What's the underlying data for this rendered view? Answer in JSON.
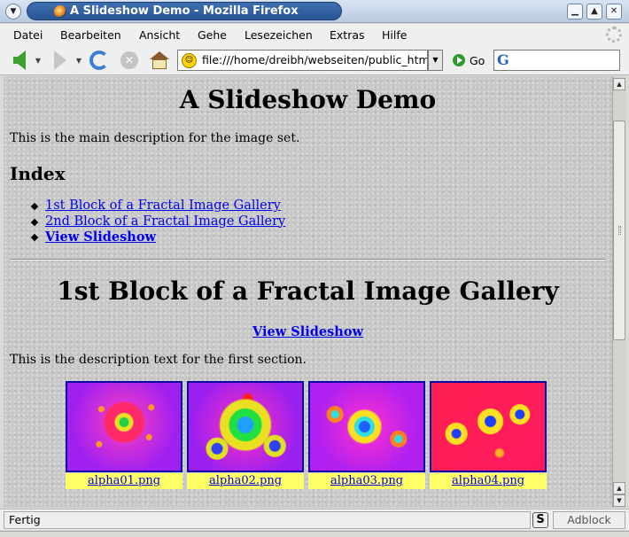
{
  "window": {
    "title": "A Slideshow Demo - Mozilla Firefox"
  },
  "menu": [
    {
      "label": "Datei"
    },
    {
      "label": "Bearbeiten"
    },
    {
      "label": "Ansicht"
    },
    {
      "label": "Gehe"
    },
    {
      "label": "Lesezeichen"
    },
    {
      "label": "Extras"
    },
    {
      "label": "Hilfe"
    }
  ],
  "toolbar": {
    "url": "file:///home/dreibh/webseiten/public_html",
    "go_label": "Go",
    "search_engine_letter": "G"
  },
  "page": {
    "title": "A Slideshow Demo",
    "main_description": "This is the main description for the image set.",
    "index_heading": "Index",
    "index_links": [
      "1st Block of a Fractal Image Gallery",
      "2nd Block of a Fractal Image Gallery",
      "View Slideshow"
    ],
    "section1": {
      "title": "1st Block of a Fractal Image Gallery",
      "slideshow_link": "View Slideshow",
      "description": "This is the description text for the first section.",
      "images": [
        {
          "caption": "alpha01.png"
        },
        {
          "caption": "alpha02.png"
        },
        {
          "caption": "alpha03.png"
        },
        {
          "caption": "alpha04.png"
        }
      ]
    }
  },
  "status": {
    "text": "Fertig",
    "adblock": "Adblock",
    "s_icon_letter": "S"
  },
  "colors": {
    "link": "#0000ee",
    "caption_bg": "#ffff66",
    "title_pill": "#2a5594"
  }
}
